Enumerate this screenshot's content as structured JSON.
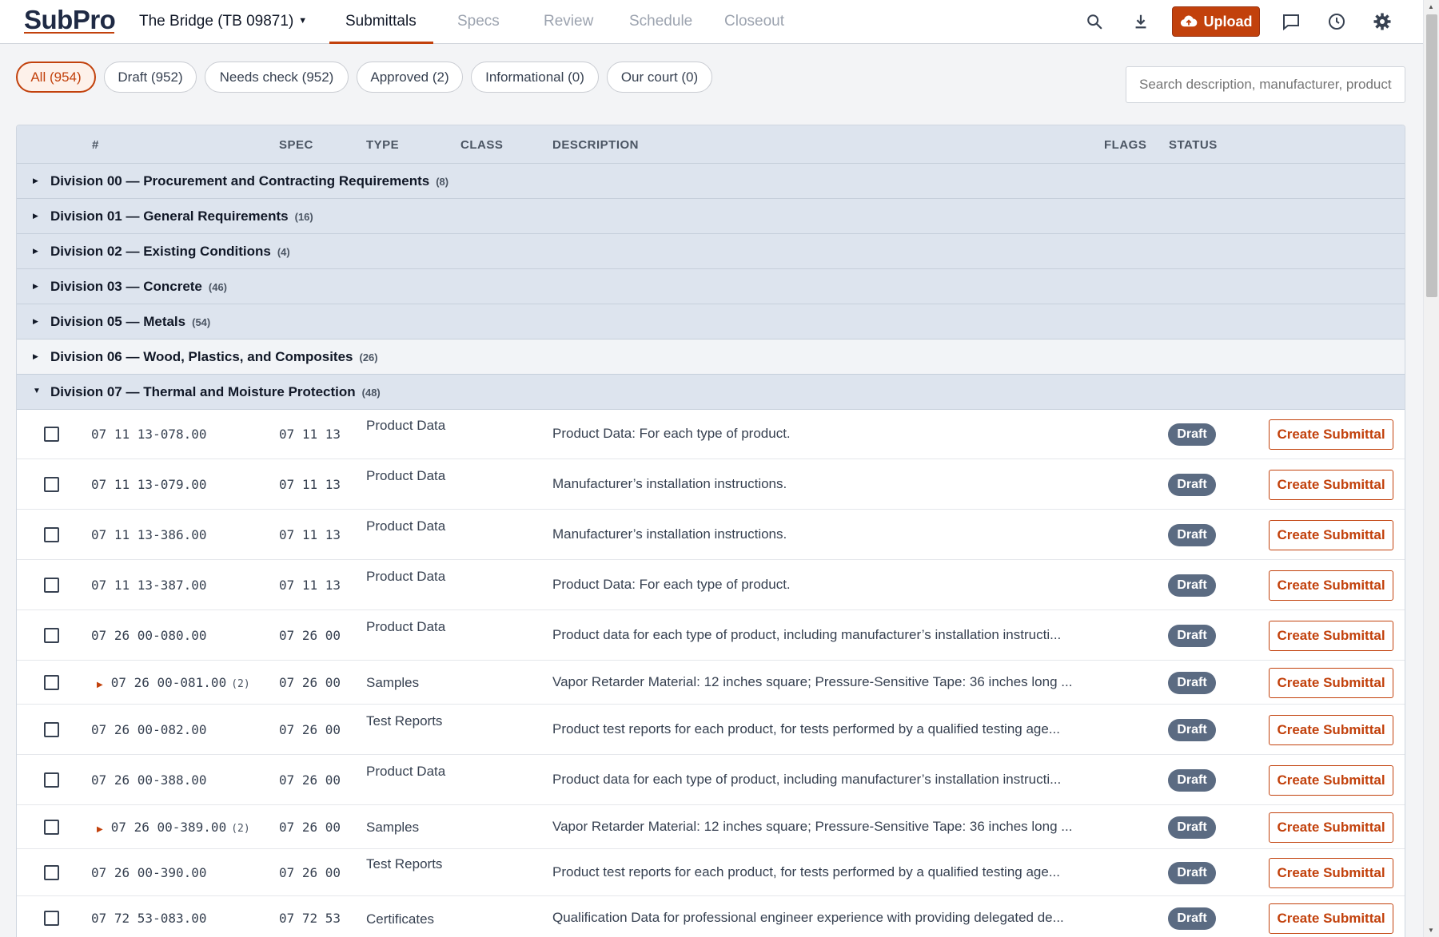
{
  "header": {
    "logo_sub": "Sub",
    "logo_pro": "Pro",
    "project": "The Bridge (TB 09871)",
    "tabs": [
      "Submittals",
      "Specs",
      "Review",
      "Schedule",
      "Closeout"
    ],
    "active_tab": "Submittals",
    "upload_label": "Upload",
    "accent_color": "#c2410c"
  },
  "filters": [
    {
      "label": "All (954)",
      "active": true
    },
    {
      "label": "Draft (952)",
      "active": false
    },
    {
      "label": "Needs check (952)",
      "active": false
    },
    {
      "label": "Approved (2)",
      "active": false
    },
    {
      "label": "Informational (0)",
      "active": false
    },
    {
      "label": "Our court (0)",
      "active": false
    }
  ],
  "search": {
    "placeholder": "Search description, manufacturer, product..."
  },
  "columns": {
    "num": "#",
    "spec": "SPEC",
    "type": "TYPE",
    "class": "CLASS",
    "description": "DESCRIPTION",
    "flags": "FLAGS",
    "status": "STATUS"
  },
  "divisions": [
    {
      "title": "Division 00 — Procurement and Contracting Requirements",
      "count": "(8)",
      "expanded": false
    },
    {
      "title": "Division 01 — General Requirements",
      "count": "(16)",
      "expanded": false
    },
    {
      "title": "Division 02 — Existing Conditions",
      "count": "(4)",
      "expanded": false
    },
    {
      "title": "Division 03 — Concrete",
      "count": "(46)",
      "expanded": false
    },
    {
      "title": "Division 05 — Metals",
      "count": "(54)",
      "expanded": false
    },
    {
      "title": "Division 06 — Wood, Plastics, and Composites",
      "count": "(26)",
      "expanded": false
    },
    {
      "title": "Division 07 — Thermal and Moisture Protection",
      "count": "(48)",
      "expanded": true
    }
  ],
  "rows": [
    {
      "num": "07 11 13-078.00",
      "spec": "07 11 13",
      "type": "Product Data",
      "desc": "Product Data: For each type of product.",
      "status": "Draft",
      "action": "Create Submittal"
    },
    {
      "num": "07 11 13-079.00",
      "spec": "07 11 13",
      "type": "Product Data",
      "desc": "Manufacturer’s installation instructions.",
      "status": "Draft",
      "action": "Create Submittal"
    },
    {
      "num": "07 11 13-386.00",
      "spec": "07 11 13",
      "type": "Product Data",
      "desc": "Manufacturer’s installation instructions.",
      "status": "Draft",
      "action": "Create Submittal"
    },
    {
      "num": "07 11 13-387.00",
      "spec": "07 11 13",
      "type": "Product Data",
      "desc": "Product Data: For each type of product.",
      "status": "Draft",
      "action": "Create Submittal"
    },
    {
      "num": "07 26 00-080.00",
      "spec": "07 26 00",
      "type": "Product Data",
      "desc": "Product data for each type of product, including manufacturer’s installation instructi...",
      "status": "Draft",
      "action": "Create Submittal"
    },
    {
      "num": "07 26 00-081.00",
      "sub": "(2)",
      "spec": "07 26 00",
      "type": "Samples",
      "desc": "Vapor Retarder Material: 12 inches square; Pressure-Sensitive Tape: 36 inches long ...",
      "status": "Draft",
      "action": "Create Submittal"
    },
    {
      "num": "07 26 00-082.00",
      "spec": "07 26 00",
      "type": "Test Reports",
      "desc": "Product test reports for each product, for tests performed by a qualified testing age...",
      "status": "Draft",
      "action": "Create Submittal"
    },
    {
      "num": "07 26 00-388.00",
      "spec": "07 26 00",
      "type": "Product Data",
      "desc": "Product data for each type of product, including manufacturer’s installation instructi...",
      "status": "Draft",
      "action": "Create Submittal"
    },
    {
      "num": "07 26 00-389.00",
      "sub": "(2)",
      "spec": "07 26 00",
      "type": "Samples",
      "desc": "Vapor Retarder Material: 12 inches square; Pressure-Sensitive Tape: 36 inches long ...",
      "status": "Draft",
      "action": "Create Submittal"
    },
    {
      "num": "07 26 00-390.00",
      "spec": "07 26 00",
      "type": "Test Reports",
      "desc": "Product test reports for each product, for tests performed by a qualified testing age...",
      "status": "Draft",
      "action": "Create Submittal"
    },
    {
      "num": "07 72 53-083.00",
      "spec": "07 72 53",
      "type": "Certificates",
      "desc": "Qualification Data for professional engineer experience with providing delegated de...",
      "status": "Draft",
      "action": "Create Submittal"
    }
  ]
}
